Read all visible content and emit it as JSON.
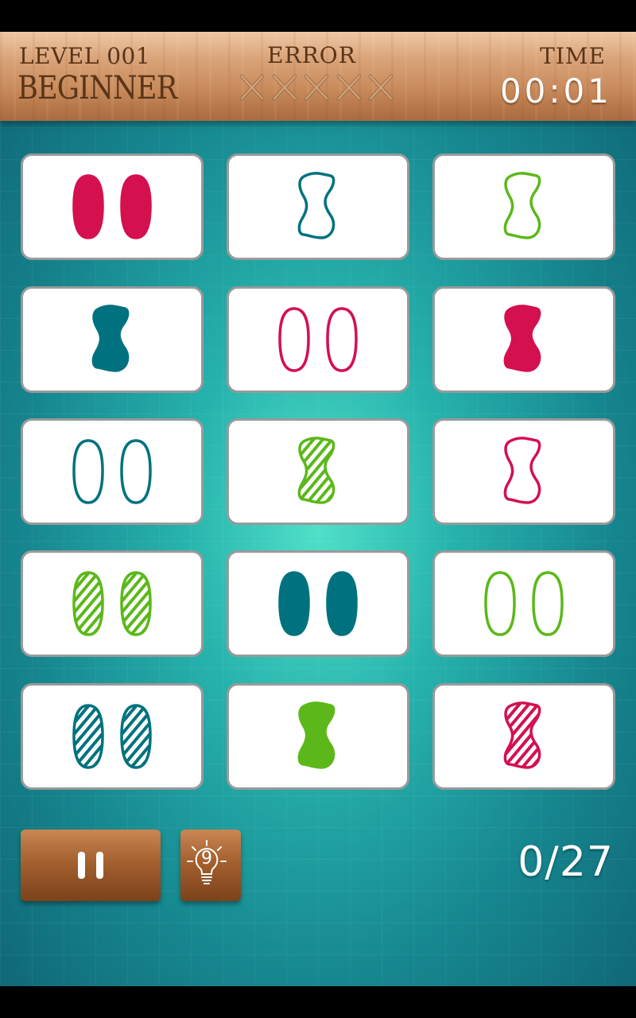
{
  "header": {
    "level_label": "LEVEL 001",
    "difficulty": "BEGINNER",
    "error_label": "ERROR",
    "error_marks": [
      "x-mark-icon",
      "x-mark-icon",
      "x-mark-icon",
      "x-mark-icon",
      "x-mark-icon"
    ],
    "time_label": "TIME",
    "time_value": "00:01"
  },
  "colors": {
    "crimson": "#d4104f",
    "teal": "#00727f",
    "green": "#5cb81a",
    "wood": "#a86a3f"
  },
  "cards": [
    {
      "count": 2,
      "shape": "oval",
      "fill": "solid",
      "color": "crimson"
    },
    {
      "count": 1,
      "shape": "squiggle",
      "fill": "outline",
      "color": "teal"
    },
    {
      "count": 1,
      "shape": "squiggle",
      "fill": "outline",
      "color": "green"
    },
    {
      "count": 1,
      "shape": "squiggle",
      "fill": "solid",
      "color": "teal"
    },
    {
      "count": 2,
      "shape": "oval",
      "fill": "outline",
      "color": "crimson"
    },
    {
      "count": 1,
      "shape": "squiggle",
      "fill": "solid",
      "color": "crimson"
    },
    {
      "count": 2,
      "shape": "oval",
      "fill": "outline",
      "color": "teal"
    },
    {
      "count": 1,
      "shape": "squiggle",
      "fill": "striped",
      "color": "green"
    },
    {
      "count": 1,
      "shape": "squiggle",
      "fill": "outline",
      "color": "crimson"
    },
    {
      "count": 2,
      "shape": "oval",
      "fill": "striped",
      "color": "green"
    },
    {
      "count": 2,
      "shape": "oval",
      "fill": "solid",
      "color": "teal"
    },
    {
      "count": 2,
      "shape": "oval",
      "fill": "outline",
      "color": "green"
    },
    {
      "count": 2,
      "shape": "oval",
      "fill": "striped",
      "color": "teal"
    },
    {
      "count": 1,
      "shape": "squiggle",
      "fill": "solid",
      "color": "green"
    },
    {
      "count": 1,
      "shape": "squiggle",
      "fill": "striped",
      "color": "crimson"
    }
  ],
  "controls": {
    "pause_icon": "pause-icon",
    "hint_icon": "lightbulb-icon",
    "hint_count": "9"
  },
  "progress": "0/27"
}
